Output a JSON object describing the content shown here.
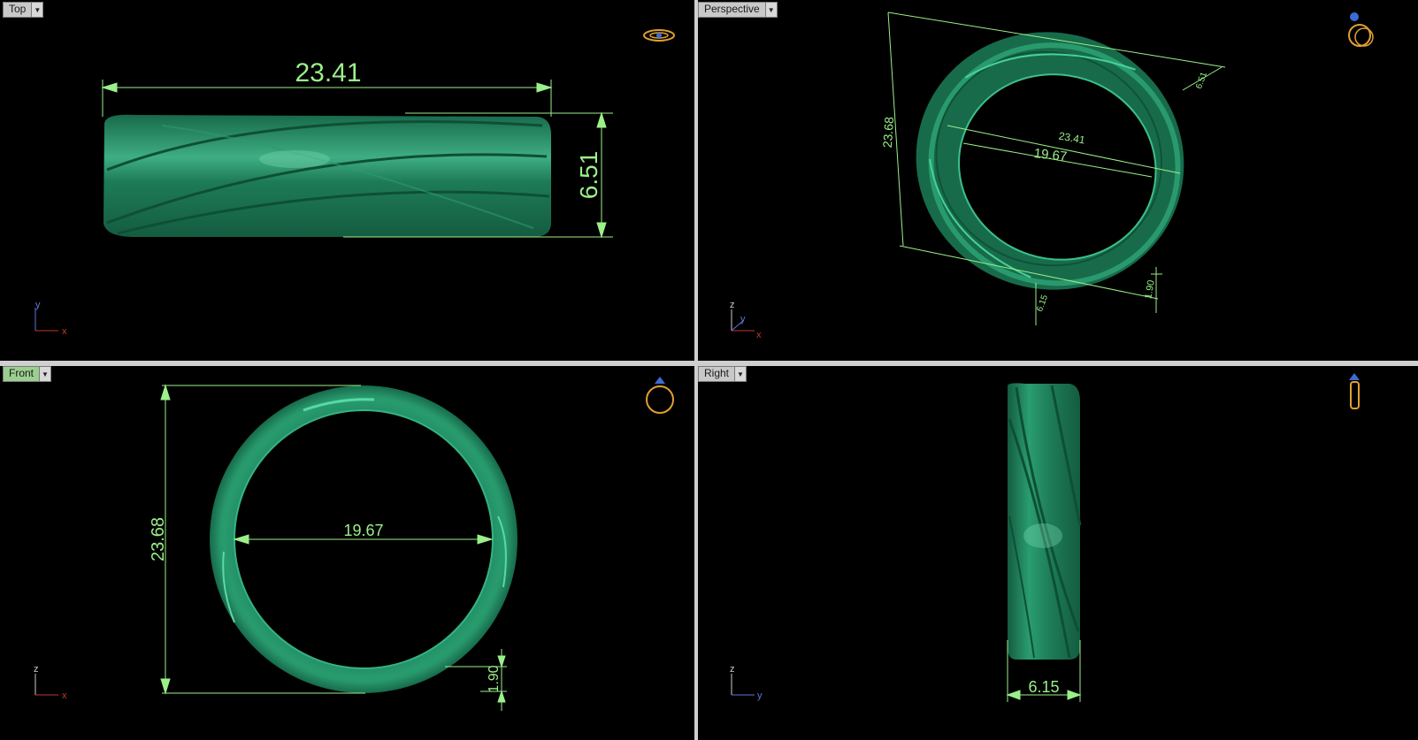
{
  "viewports": {
    "top": {
      "title": "Top",
      "width": "23.41",
      "height": "6.51",
      "axis_h": "x",
      "axis_v": "y"
    },
    "perspective": {
      "title": "Perspective",
      "outer_height": "23.68",
      "inner_width": "19.67",
      "width": "23.41",
      "height": "6.51",
      "thickness": "1.90",
      "band": "6.15",
      "axis_a": "z",
      "axis_b": "y",
      "axis_c": "x"
    },
    "front": {
      "title": "Front",
      "outer_height": "23.68",
      "inner_width": "19.67",
      "thickness": "1.90",
      "axis_h": "x",
      "axis_v": "z"
    },
    "right": {
      "title": "Right",
      "band_width": "6.15",
      "axis_h": "y",
      "axis_v": "z"
    }
  },
  "colors": {
    "ring": "#1f8a62",
    "ring_highlight": "#4fc59a",
    "dimension": "#9bf08a",
    "active_tab": "#9bcf8f",
    "axis_x": "#c0392b",
    "axis_y": "#4a6fd6",
    "axis_z": "#cccccc"
  },
  "icons": [
    "ring-top-view-icon",
    "ring-perspective-icon",
    "ring-front-icon",
    "ring-side-icon",
    "dropdown-arrow-icon"
  ]
}
